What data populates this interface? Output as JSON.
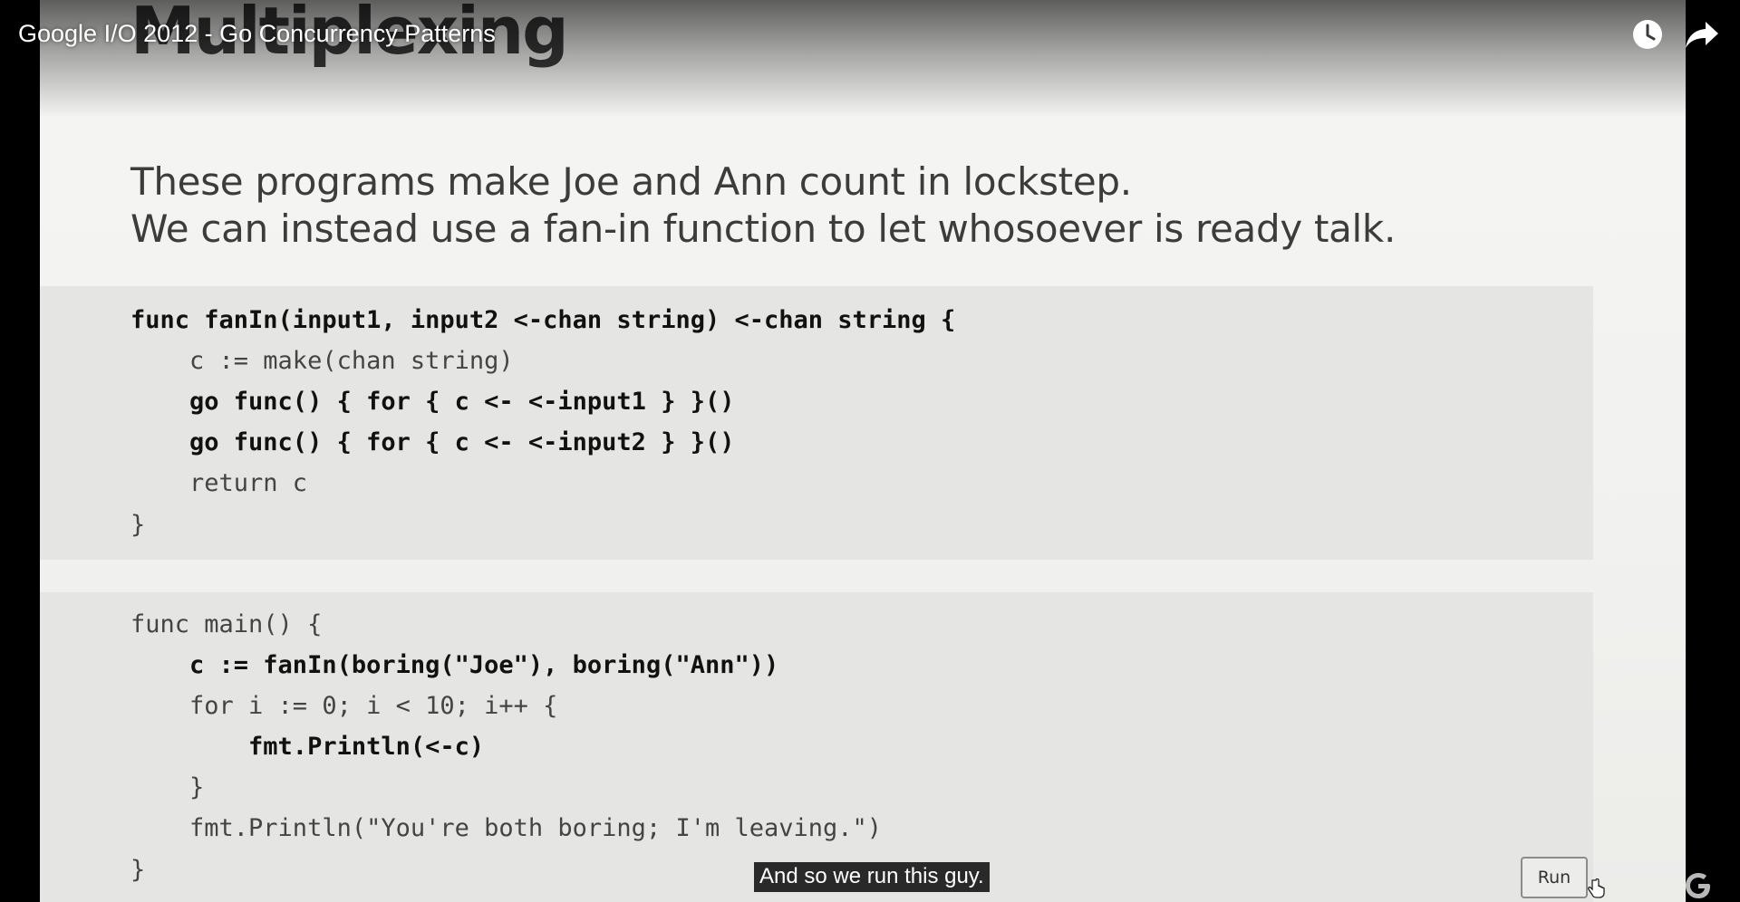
{
  "video": {
    "title": "Google I/O 2012 - Go Concurrency Patterns",
    "caption": "And so we run this guy."
  },
  "controls": {
    "watch_later_icon": "clock-icon",
    "share_icon": "share-arrow-icon",
    "watermark_icon": "google-g-icon"
  },
  "slide": {
    "title": "Multiplexing",
    "lines": [
      "These programs make Joe and Ann count in lockstep.",
      "We can instead use a fan-in function to let whosoever is ready talk."
    ],
    "code_block_1": [
      "func fanIn(input1, input2 <-chan string) <-chan string {",
      "    c := make(chan string)",
      "    go func() { for { c <- <-input1 } }()",
      "    go func() { for { c <- <-input2 } }()",
      "    return c",
      "}"
    ],
    "code_block_2": [
      "func main() {",
      "    c := fanIn(boring(\"Joe\"), boring(\"Ann\"))",
      "    for i := 0; i < 10; i++ {",
      "        fmt.Println(<-c)",
      "    }",
      "    fmt.Println(\"You're both boring; I'm leaving.\")",
      "}"
    ],
    "run_label": "Run"
  },
  "colors": {
    "slide_background": "#f3f3f1",
    "code_background": "#e5e5e3",
    "caption_background": "#080808"
  }
}
